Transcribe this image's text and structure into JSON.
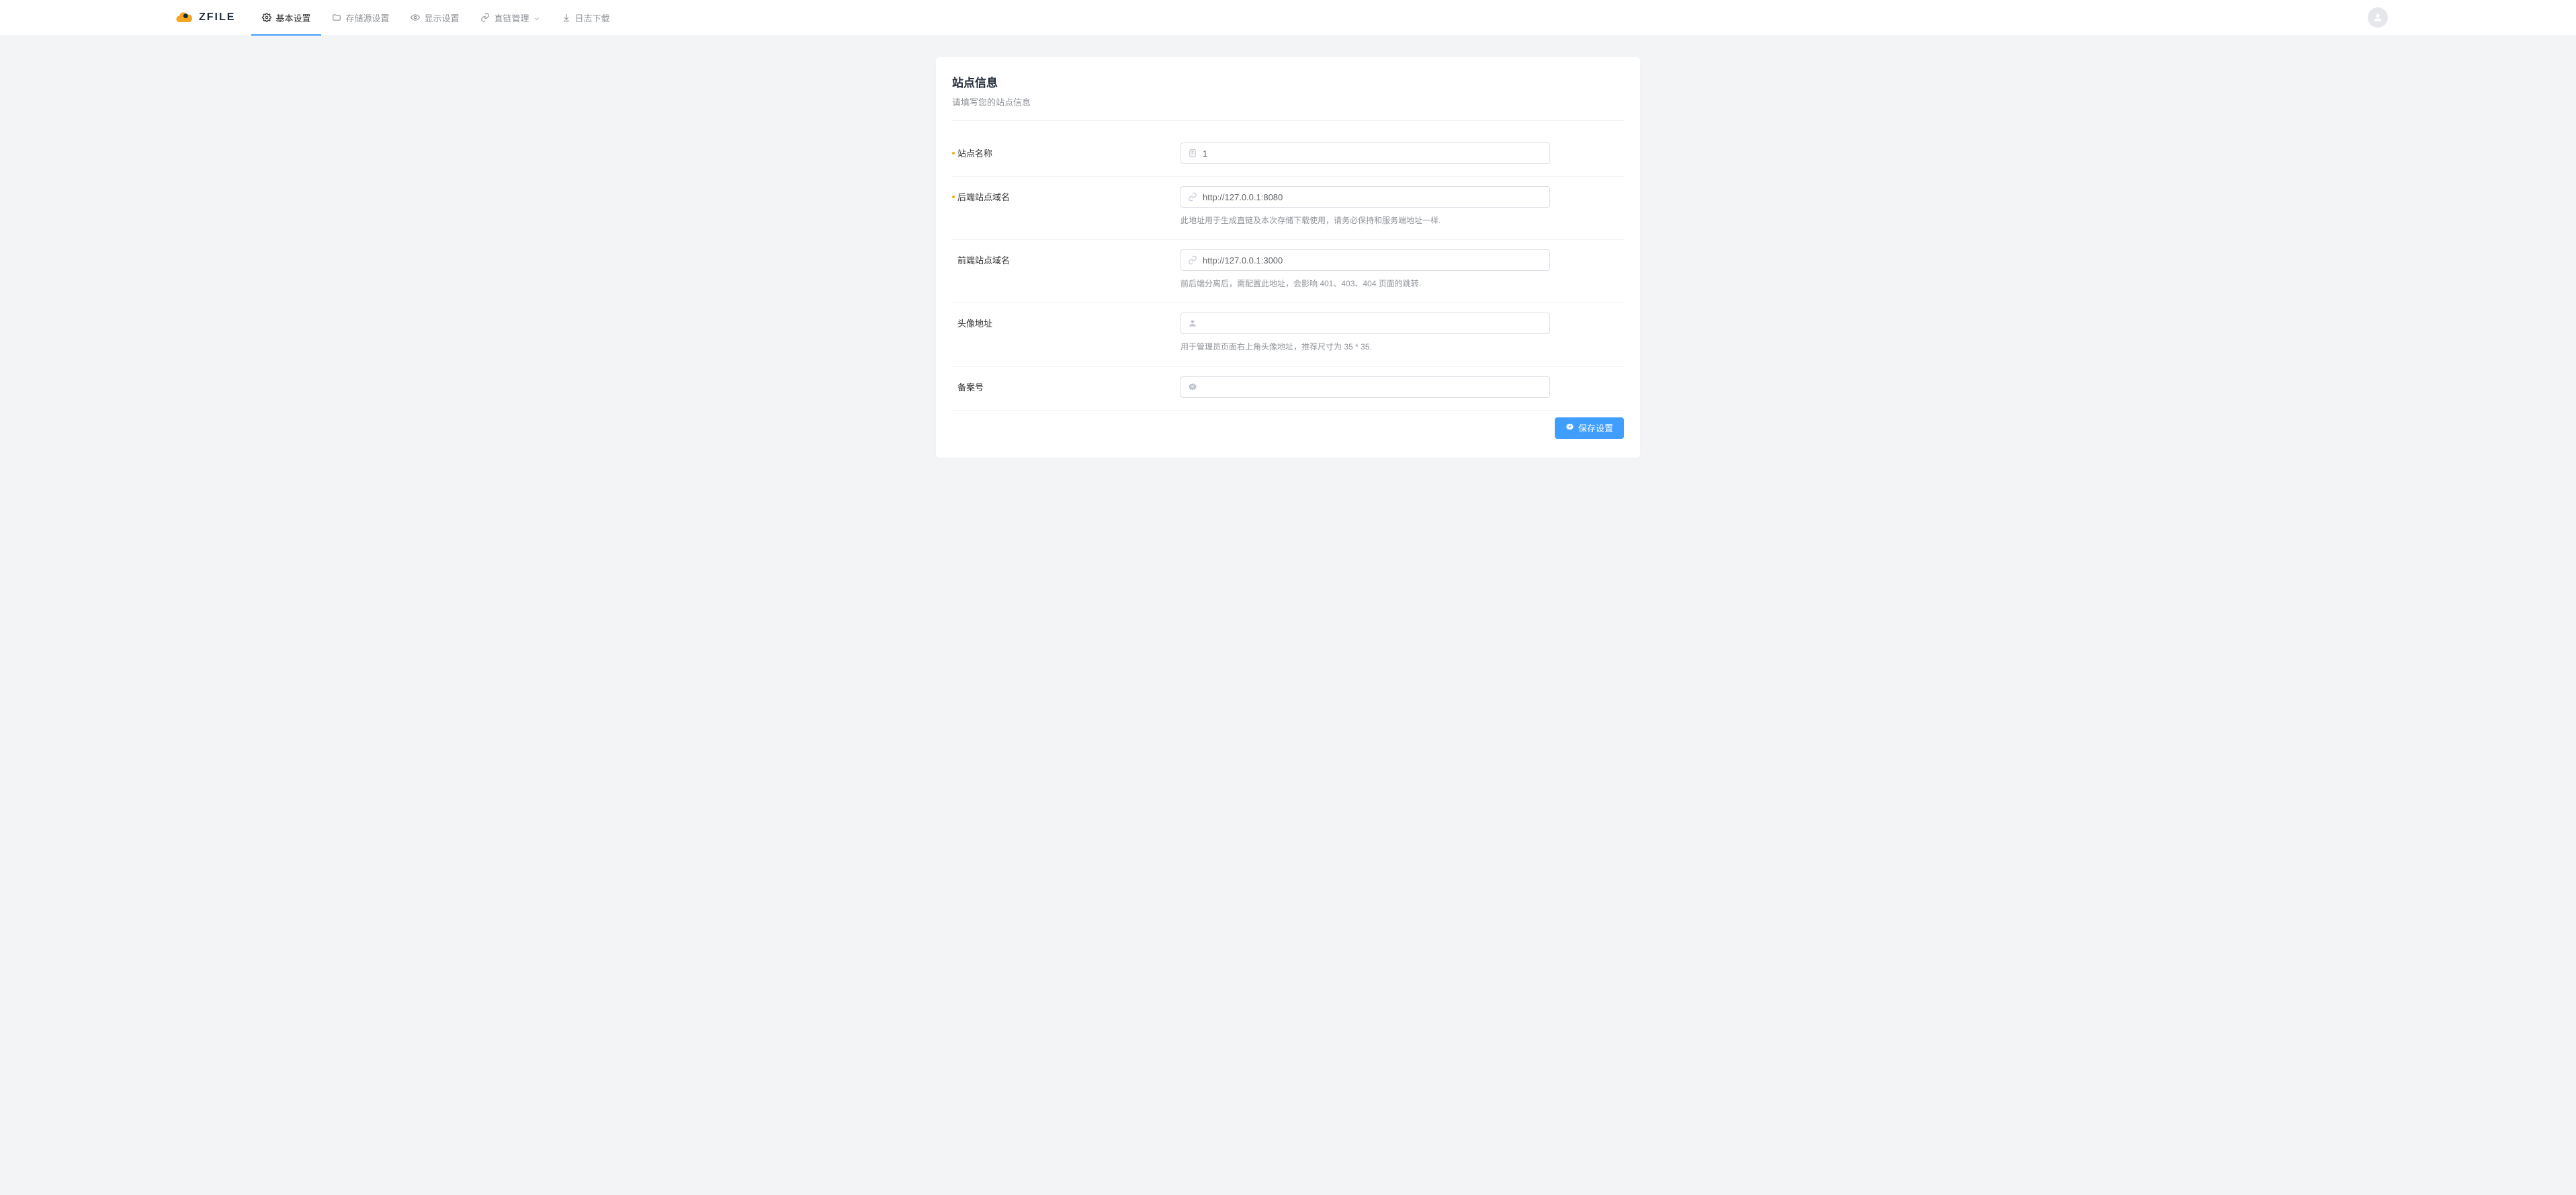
{
  "header": {
    "logo_text": "ZFILE",
    "nav": [
      {
        "icon": "gear-icon",
        "label": "基本设置",
        "active": true
      },
      {
        "icon": "folder-icon",
        "label": "存储源设置"
      },
      {
        "icon": "eye-icon",
        "label": "显示设置"
      },
      {
        "icon": "link-icon",
        "label": "直链管理",
        "has_dropdown": true
      },
      {
        "icon": "download-icon",
        "label": "日志下载"
      }
    ]
  },
  "section": {
    "title": "站点信息",
    "desc": "请填写您的站点信息"
  },
  "form": {
    "site_name": {
      "label": "站点名称",
      "required": true,
      "value": "1",
      "placeholder": ""
    },
    "backend_url": {
      "label": "后端站点域名",
      "required": true,
      "value": "http://127.0.0.1:8080",
      "help": "此地址用于生成直链及本次存储下载使用，请务必保持和服务端地址一样."
    },
    "frontend_url": {
      "label": "前端站点域名",
      "required": false,
      "value": "http://127.0.0.1:3000",
      "help": "前后端分离后，需配置此地址，会影响 401、403、404 页面的跳转."
    },
    "avatar_url": {
      "label": "头像地址",
      "required": false,
      "value": "",
      "help": "用于管理员页面右上角头像地址，推荐尺寸为 35 * 35."
    },
    "beian": {
      "label": "备案号",
      "required": false,
      "value": ""
    }
  },
  "actions": {
    "save_label": "保存设置"
  }
}
